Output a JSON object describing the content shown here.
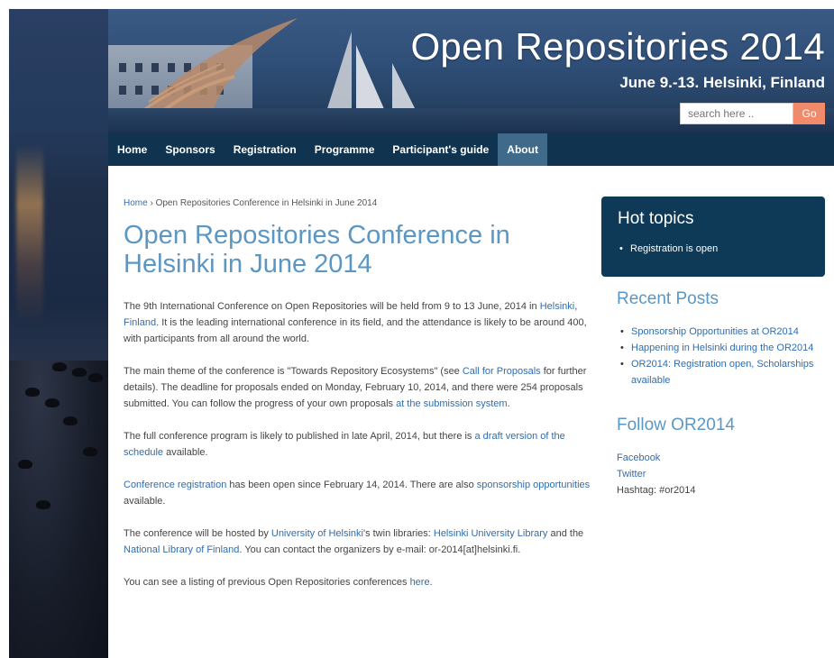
{
  "header": {
    "title": "Open Repositories 2014",
    "subtitle": "June 9.-13. Helsinki, Finland",
    "search_placeholder": "search here ..",
    "search_button": "Go"
  },
  "nav": {
    "items": [
      {
        "label": "Home"
      },
      {
        "label": "Sponsors"
      },
      {
        "label": "Registration"
      },
      {
        "label": "Programme"
      },
      {
        "label": "Participant's guide"
      },
      {
        "label": "About",
        "active": true
      }
    ]
  },
  "breadcrumb": {
    "home": "Home",
    "separator": " › ",
    "current": "Open Repositories Conference in Helsinki in June 2014"
  },
  "main": {
    "title": "Open Repositories Conference in Helsinki in June 2014",
    "p1": {
      "t1": "The 9th International Conference on Open Repositories will be held from 9 to 13 June, 2014 in ",
      "link1": "Helsinki",
      "t2": ", ",
      "link2": "Finland",
      "t3": ". It is the leading international conference in its field, and the attendance is likely to be around 400, with participants from all around the world."
    },
    "p2": {
      "t1": "The main theme of the conference is \"Towards Repository Ecosystems\" (see ",
      "link1": "Call for Proposals",
      "t2": " for further details). The deadline for proposals ended on Monday, February 10, 2014, and there were 254 proposals submitted. You can follow the progress of your own proposals ",
      "link2": "at the submission system",
      "t3": "."
    },
    "p3": {
      "t1": "The full conference program is likely to published in late April, 2014, but there is ",
      "link1": "a draft version of the schedule",
      "t2": " available."
    },
    "p4": {
      "link1": "Conference registration",
      "t1": " has been open since February 14, 2014. There are also ",
      "link2": "sponsorship opportunities",
      "t2": " available."
    },
    "p5": {
      "t1": "The conference will be hosted by ",
      "link1": "University of Helsinki",
      "t2": "'s twin libraries: ",
      "link2": "Helsinki University Library",
      "t3": " and the ",
      "link3": "National Library of Finland",
      "t4": ". You can contact the organizers by e-mail: or-2014[at]helsinki.fi."
    },
    "p6": {
      "t1": "You can see a listing of previous Open Repositories conferences ",
      "link1": "here",
      "t2": "."
    }
  },
  "sidebar": {
    "hot_topics": {
      "title": "Hot topics",
      "items": [
        "Registration is open"
      ]
    },
    "recent_posts": {
      "title": "Recent Posts",
      "items": [
        "Sponsorship Opportunities at OR2014",
        "Happening in Helsinki during the OR2014",
        "OR2014: Registration open, Scholarships available"
      ]
    },
    "follow": {
      "title": "Follow OR2014",
      "facebook": "Facebook",
      "twitter": "Twitter",
      "hashtag": "Hashtag: #or2014"
    }
  },
  "colors": {
    "nav_bg": "#103450",
    "nav_active": "#3f6a8a",
    "title_blue": "#5a97c4",
    "link_blue": "#2f6db0",
    "hot_box": "#0e3a58",
    "go_button": "#f08a6a"
  }
}
